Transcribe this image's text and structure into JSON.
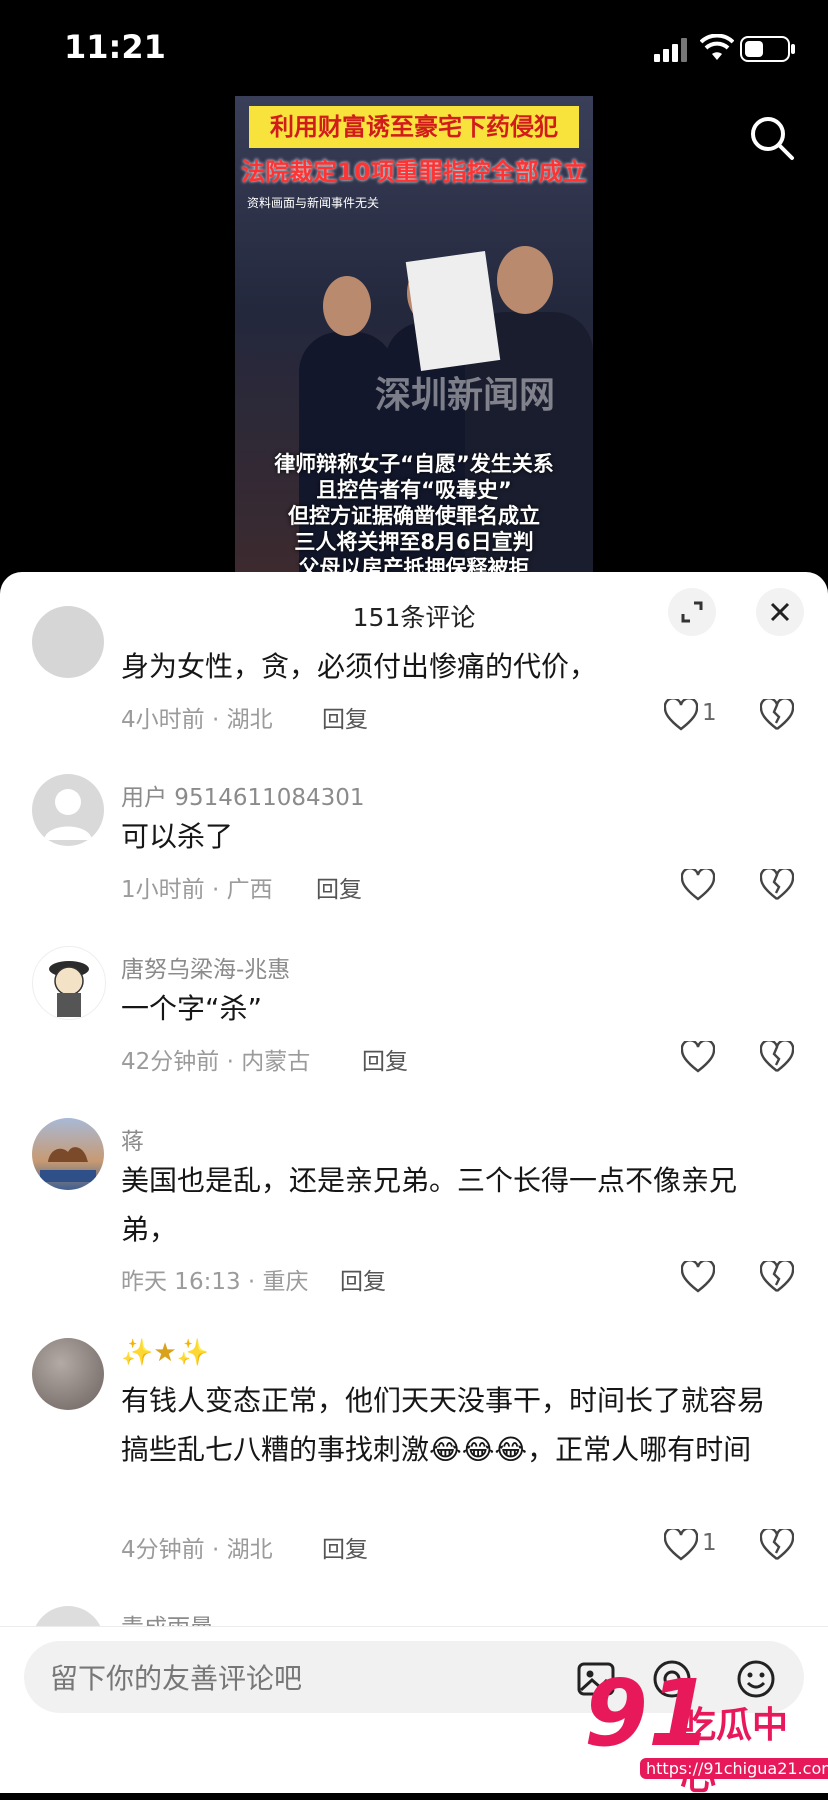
{
  "status_bar": {
    "time": "11:21"
  },
  "video": {
    "headline_1": "利用财富诱至豪宅下药侵犯",
    "headline_2": "法院裁定10项重罪指控全部成立",
    "note": "资料画面与新闻事件无关",
    "watermark": "深圳新闻网",
    "subtitles": [
      "律师辩称女子“自愿”发生关系",
      "且控告者有“吸毒史”",
      "但控方证据确凿使罪名成立",
      "三人将关押至8月6日宣判",
      "父母以房产抵押保释被拒"
    ]
  },
  "comments_panel": {
    "title": "151条评论",
    "comments": [
      {
        "user": "",
        "text": "身为女性，贪，必须付出惨痛的代价，",
        "time": "4小时前",
        "location": "湖北",
        "reply": "回复",
        "likes": "1"
      },
      {
        "user": "用户 9514611084301",
        "text": "可以杀了",
        "time": "1小时前",
        "location": "广西",
        "reply": "回复",
        "likes": ""
      },
      {
        "user": "唐努乌梁海-兆惠",
        "text": "一个字“杀”",
        "time": "42分钟前",
        "location": "内蒙古",
        "reply": "回复",
        "likes": ""
      },
      {
        "user": "蒋",
        "text": "美国也是乱，还是亲兄弟。三个长得一点不像亲兄弟，",
        "time": "昨天 16:13",
        "location": "重庆",
        "reply": "回复",
        "likes": ""
      },
      {
        "user": "✨★✨",
        "text": "有钱人变态正常，他们天天没事干，时间长了就容易搞些乱七八糟的事找刺激😂😂😂，正常人哪有时间",
        "time": "4分钟前",
        "location": "湖北",
        "reply": "回复",
        "likes": "1"
      },
      {
        "user": "青成雨曼"
      }
    ]
  },
  "input": {
    "placeholder": "留下你的友善评论吧"
  },
  "watermark_logo": {
    "number": "91",
    "text": "吃瓜中心",
    "url": "https://91chigua21.com"
  }
}
